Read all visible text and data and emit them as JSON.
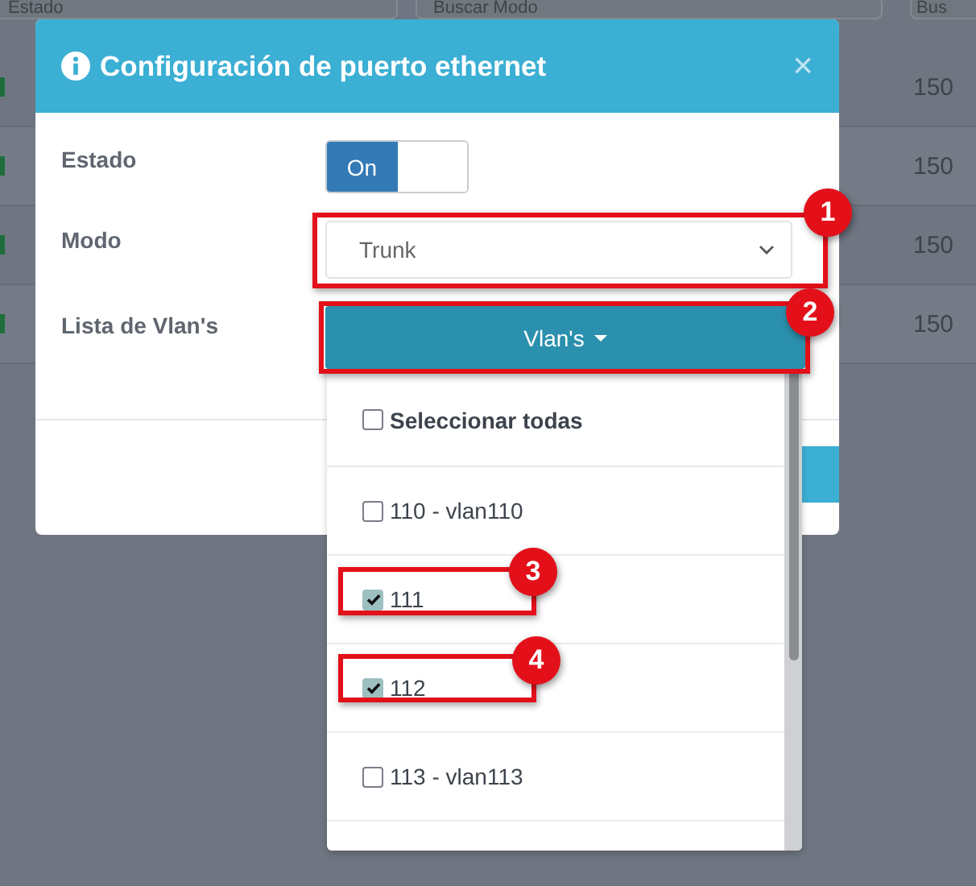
{
  "background": {
    "search_fields": [
      {
        "placeholder": "Estado"
      },
      {
        "placeholder": "Buscar Modo"
      },
      {
        "placeholder": "Bus"
      }
    ],
    "rows": [
      {
        "column_1": "150"
      },
      {
        "column_1": "150"
      },
      {
        "column_1": "150"
      },
      {
        "column_1": "150"
      }
    ]
  },
  "modal": {
    "title": "Configuración de puerto ethernet",
    "close": "×",
    "fields": [
      {
        "kind": "toggle",
        "label": "Estado",
        "on": true,
        "on_text": "On"
      },
      {
        "kind": "select",
        "label": "Modo",
        "value": "Trunk"
      },
      {
        "kind": "dropdown",
        "label": "Lista de Vlan's",
        "button": "Vlan's"
      }
    ]
  },
  "vlan_menu": {
    "items": [
      {
        "label": "Seleccionar todas",
        "checked": false
      },
      {
        "label": "110 - vlan110",
        "checked": false
      },
      {
        "label": "111",
        "checked": true
      },
      {
        "label": "112",
        "checked": true
      },
      {
        "label": "113 - vlan113",
        "checked": false
      }
    ]
  },
  "callouts": [
    {
      "number": "1"
    },
    {
      "number": "2"
    },
    {
      "number": "3"
    },
    {
      "number": "4"
    }
  ]
}
